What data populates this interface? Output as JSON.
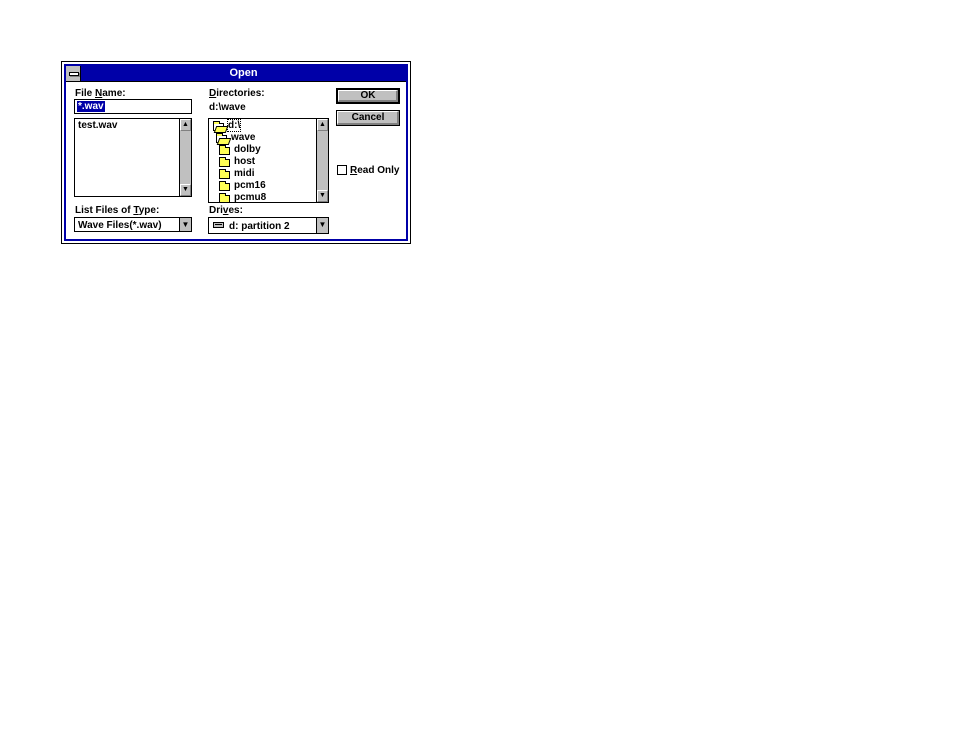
{
  "dialog": {
    "title": "Open",
    "file_name": {
      "label_pre": "File ",
      "label_accel": "N",
      "label_post": "ame:",
      "value": "*.wav",
      "files": [
        "test.wav"
      ]
    },
    "directories": {
      "label_accel": "D",
      "label_post": "irectories:",
      "current": "d:\\wave",
      "items": [
        {
          "name": "d:\\",
          "icon": "open-folder-icon"
        },
        {
          "name": "wave",
          "icon": "open-folder-icon"
        },
        {
          "name": "dolby",
          "icon": "folder-icon"
        },
        {
          "name": "host",
          "icon": "folder-icon"
        },
        {
          "name": "midi",
          "icon": "folder-icon"
        },
        {
          "name": "pcm16",
          "icon": "folder-icon"
        },
        {
          "name": "pcmu8",
          "icon": "folder-icon"
        }
      ]
    },
    "list_type": {
      "label_pre": "List Files of ",
      "label_accel": "T",
      "label_post": "ype:",
      "value": "Wave Files(*.wav)"
    },
    "drives": {
      "label_pre": "Dri",
      "label_accel": "v",
      "label_post": "es:",
      "value": "d: partition 2",
      "icon": "hard-drive-icon"
    },
    "ok_label": "OK",
    "cancel_label": "Cancel",
    "read_only": {
      "label_accel": "R",
      "label_post": "ead Only",
      "checked": false
    }
  },
  "colors": {
    "titlebar": "#0000a8",
    "face": "#c0c0c0",
    "folder": "#ffff55"
  }
}
